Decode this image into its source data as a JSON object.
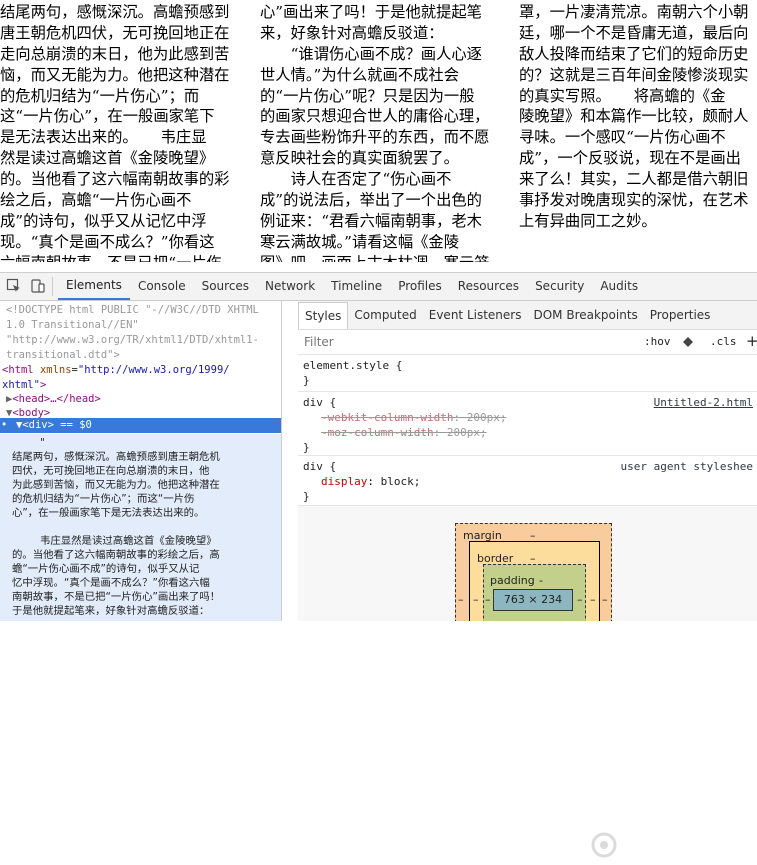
{
  "page": {
    "col1": [
      "结尾两句，感慨深沉。高蟾预感到",
      "唐王朝危机四伏，无可挽回地正在",
      "走向总崩溃的末日，他为此感到苦",
      "恼，而又无能为力。他把这种潜在",
      "的危机归结为“一片伤心”；而",
      "这“一片伤心”，在一般画家笔下",
      "是无法表达出来的。　　韦庄显",
      "然是读过高蟾这首《金陵晚望》",
      "的。当他看了这六幅南朝故事的彩",
      "绘之后，高蟾“一片伤心画不",
      "成”的诗句，似乎又从记忆中浮",
      "现。“真个是画不成么？”你看这",
      "六幅南朝故事，不是已把“一片伤"
    ],
    "col2": [
      "心”画出来了吗！于是他就提起笔",
      "来，好象针对高蟾反驳道：",
      "　　“谁谓伤心画不成？画人心逐",
      "世人情。”为什么就画不成社会",
      "的“一片伤心”呢？只是因为一般",
      "的画家只想迎合世人的庸俗心理，",
      "专去画些粉饰升平的东西，而不愿",
      "意反映社会的真实面貌罢了。",
      "　　诗人在否定了“伤心画不",
      "成”的说法后，举出了一个出色的",
      "例证来：“君看六幅南朝事，老木",
      "寒云满故城。”请看这幅《金陵",
      "图》吧，画面上古木枯凋，寒云笼"
    ],
    "col3": [
      "罩，一片凄清荒凉。南朝六个小朝",
      "廷，哪一个不是昏庸无道，最后向",
      "敌人投降而结束了它们的短命历史",
      "的？这就是三百年间金陵惨淡现实",
      "的真实写照。　　将高蟾的《金",
      "陵晚望》和本篇作一比较，颇耐人",
      "寻味。一个感叹“一片伤心画不",
      "成”，一个反驳说，现在不是画出",
      "来了么！其实，二人都是借六朝旧",
      "事抒发对晚唐现实的深忧，在艺术",
      "上有异曲同工之妙。"
    ]
  },
  "devtools": {
    "tabs": [
      "Elements",
      "Console",
      "Sources",
      "Network",
      "Timeline",
      "Profiles",
      "Resources",
      "Security",
      "Audits"
    ],
    "active_tab": "Elements",
    "dom": {
      "doctype_1": "<!DOCTYPE html PUBLIC \"-//W3C//DTD XHTML",
      "doctype_2": "1.0 Transitional//EN\"",
      "doctype_3": "\"http://www.w3.org/TR/xhtml1/DTD/xhtml1-",
      "doctype_4": "transitional.dtd\">",
      "html_open_tag": "<html",
      "html_attr_name": "xmlns",
      "html_attr_val": "\"http://www.w3.org/1999/",
      "html_attr_val2": "xhtml\"",
      "html_close": ">",
      "head": "<head>…</head>",
      "body": "<body>",
      "selected": "▼<div> == $0",
      "text_node": [
        "\"",
        "结尾两句，感慨深沉。高蟾预感到唐王朝危机",
        "四伏，无可挽回地正在向总崩溃的末日，他",
        "为此感到苦恼，而又无能为力。他把这种潜在",
        "的危机归结为“一片伤心”；而这“一片伤",
        "心”，在一般画家笔下是无法表达出来的。",
        "",
        "韦庄显然是读过高蟾这首《金陵晚望》",
        "的。当他看了这六幅南朝故事的彩绘之后，高",
        "蟾“一片伤心画不成”的诗句，似乎又从记",
        "忆中浮现。“真个是画不成么？”你看这六幅",
        "南朝故事，不是已把“一片伤心”画出来了吗！",
        "于是他就提起笔来，好象针对高蟾反驳道："
      ]
    },
    "styles": {
      "tabs": [
        "Styles",
        "Computed",
        "Event Listeners",
        "DOM Breakpoints",
        "Properties"
      ],
      "active_tab": "Styles",
      "filter_placeholder": "Filter",
      "hov": ":hov",
      "cls": ".cls",
      "plus": "+",
      "rule1": {
        "selector": "element.style {",
        "close": "}"
      },
      "rule2": {
        "selector": "div {",
        "source": "Untitled-2.html",
        "prop1_name": "-webkit-column-width",
        "prop1_val": "200px;",
        "prop2_name": "-moz-column-width",
        "prop2_val": "200px;",
        "close": "}"
      },
      "rule3": {
        "selector": "div {",
        "source": "user agent styleshee",
        "prop_name": "display",
        "prop_val": "block;",
        "close": "}"
      },
      "box_model": {
        "margin_label": "margin",
        "margin_value": "–",
        "border_label": "border",
        "border_value": "–",
        "padding_label": "padding",
        "padding_value": "-",
        "side_dash": "–",
        "content": "763 × 234"
      }
    }
  },
  "colors": {
    "accent": "#3879d9",
    "tag": "#881280",
    "attr": "#994500",
    "value": "#1a1aa6",
    "margin": "#f9cc9d",
    "border": "#fddd9b",
    "padding": "#c3d08b",
    "content": "#8cb6c0"
  }
}
